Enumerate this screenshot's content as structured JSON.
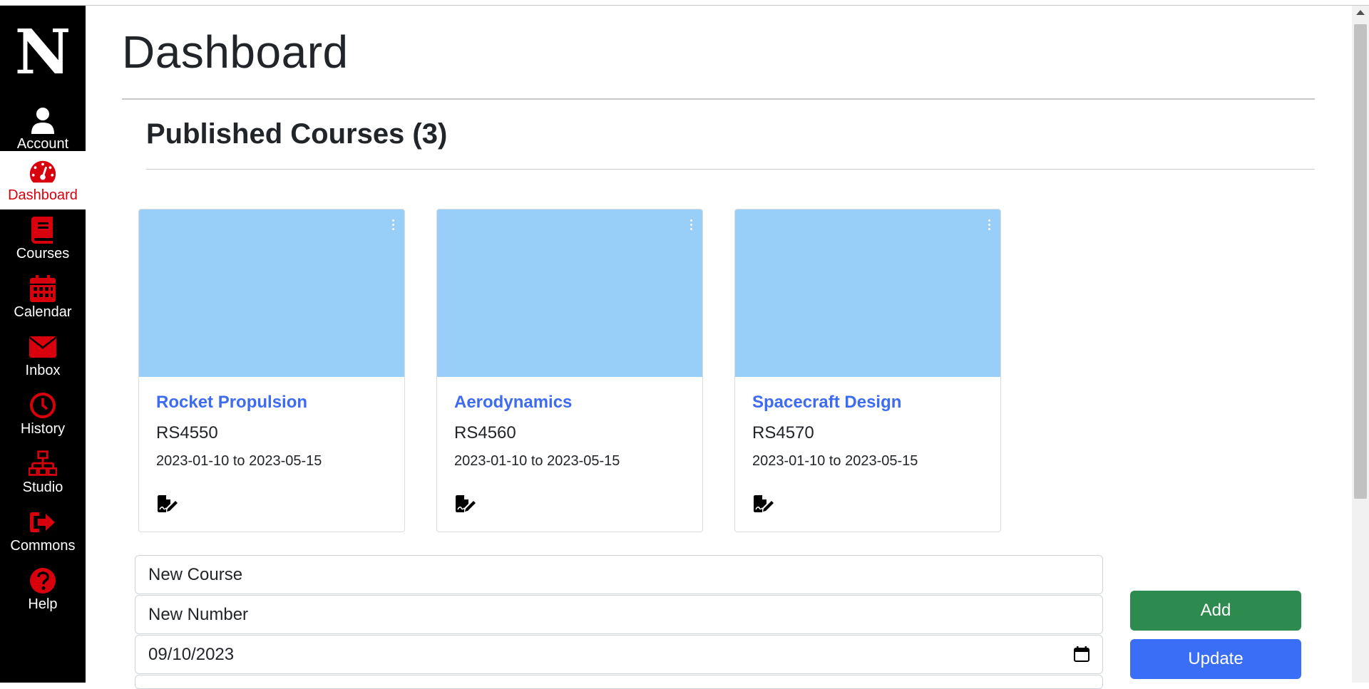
{
  "sidebar": {
    "logo": "N",
    "items": [
      {
        "label": "Account",
        "icon": "user-icon"
      },
      {
        "label": "Dashboard",
        "icon": "dashboard-gauge-icon"
      },
      {
        "label": "Courses",
        "icon": "book-icon"
      },
      {
        "label": "Calendar",
        "icon": "calendar-icon"
      },
      {
        "label": "Inbox",
        "icon": "envelope-icon"
      },
      {
        "label": "History",
        "icon": "clock-icon"
      },
      {
        "label": "Studio",
        "icon": "network-icon"
      },
      {
        "label": "Commons",
        "icon": "sign-out-icon"
      },
      {
        "label": "Help",
        "icon": "question-circle-icon"
      }
    ],
    "active": "Dashboard"
  },
  "main": {
    "title": "Dashboard",
    "section_title": "Published Courses (3)",
    "courses": [
      {
        "title": "Rocket Propulsion",
        "number": "RS4550",
        "dates": "2023-01-10 to 2023-05-15"
      },
      {
        "title": "Aerodynamics",
        "number": "RS4560",
        "dates": "2023-01-10 to 2023-05-15"
      },
      {
        "title": "Spacecraft Design",
        "number": "RS4570",
        "dates": "2023-01-10 to 2023-05-15"
      }
    ]
  },
  "form": {
    "new_course_placeholder": "New Course",
    "new_number_placeholder": "New Number",
    "date_value": "09/10/2023",
    "add_label": "Add",
    "update_label": "Update"
  },
  "colors": {
    "sidebar_bg": "#000000",
    "accent_red": "#d9000d",
    "card_image": "#98cff9",
    "course_link": "#3d6bf2",
    "add_button": "#2e8b4f",
    "update_button": "#3b6ef7"
  }
}
